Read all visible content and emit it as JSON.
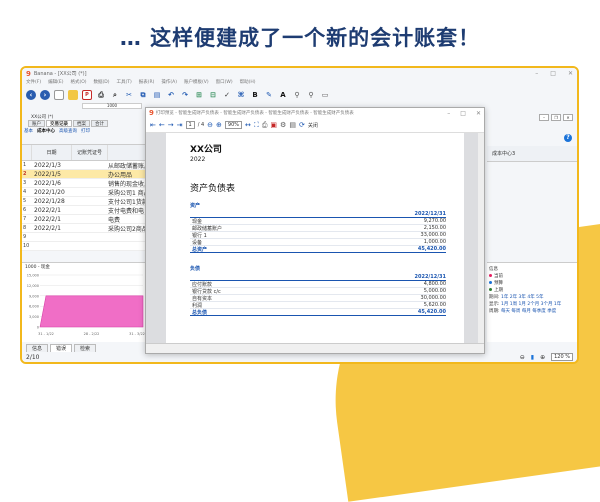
{
  "banner": "… 这样便建成了一个新的会计账套！",
  "app": {
    "title": "Banana - [XX公司 (*)]",
    "menu": [
      "文件(F)",
      "编辑(E)",
      "格式(O)",
      "数据(D)",
      "工具(T)",
      "报表(R)",
      "操作(A)",
      "账户模板(V)",
      "窗口(W)",
      "帮助(H)"
    ],
    "rownum": "1000",
    "file_tab": "XX公司 (*)",
    "doc_tabs": [
      "账户",
      "交易记录",
      "档案",
      "合计"
    ],
    "sub_tabs": [
      "基本",
      "成本中心",
      "高级查询",
      "打印"
    ],
    "columns": {
      "date": "日期",
      "voucher": "记账凭证号",
      "rightcol": "成本中心3"
    },
    "rows": [
      {
        "n": "1",
        "date": "2022/1/3",
        "desc": "从邮政储蓄账户"
      },
      {
        "n": "2",
        "date": "2022/1/5",
        "desc": "办公用品"
      },
      {
        "n": "3",
        "date": "2022/1/6",
        "desc": "销售的现金收入"
      },
      {
        "n": "4",
        "date": "2022/1/20",
        "desc": "采购公司1 商品"
      },
      {
        "n": "5",
        "date": "2022/1/28",
        "desc": "支付公司1货款"
      },
      {
        "n": "6",
        "date": "2022/2/1",
        "desc": "支付电费和电"
      },
      {
        "n": "7",
        "date": "2022/2/1",
        "desc": "电费"
      },
      {
        "n": "8",
        "date": "2022/2/1",
        "desc": "采购公司2商品"
      },
      {
        "n": "9",
        "date": "",
        "desc": ""
      },
      {
        "n": "10",
        "date": "",
        "desc": ""
      }
    ],
    "chart_title": "1000 - 现金",
    "chart_ticks": [
      "15,000",
      "12,000",
      "9,000",
      "6,000",
      "3,000",
      "0"
    ],
    "chart_xlabels": [
      "31 - 1/22",
      "28 - 2/22",
      "31 - 3/22"
    ],
    "bottom_tabs": [
      "信息",
      "错误",
      "检索"
    ],
    "status_left": "2/10",
    "zoom": "120 %",
    "right_info": {
      "heading": "信息",
      "legend": [
        "当前",
        "预算",
        "上期"
      ],
      "labels": [
        "期间:",
        "显示:",
        "周期:"
      ],
      "period_links": "1年 2年 3年 4年 5年",
      "show_links": "1月 1周 1月 2个月 3个月 1年",
      "cycle_links": "每天 每周 每月 每季度 季度"
    },
    "colors": {
      "accent": "#f2b81c",
      "link": "#1a55b0",
      "selected": "#fde9a6",
      "chart": "#f06ec6"
    }
  },
  "preview": {
    "title": "打印预览 - 智能生成财产负债表 - 智能生成财产负债表 - 智能生成财产负债表 - 智能生成财产负债表",
    "page_box": "1",
    "page_total": "/ 4",
    "zoom_box": "90%",
    "close_label": "关闭",
    "company": "XX公司",
    "year": "2022",
    "report_title": "资产负债表",
    "assets_heading": "资产",
    "assets_date": "2022/12/31",
    "assets": [
      {
        "label": "现金",
        "amount": "9,270.00"
      },
      {
        "label": "邮政储蓄账户",
        "amount": "2,150.00"
      },
      {
        "label": "银行 1",
        "amount": "33,000.00"
      },
      {
        "label": "设备",
        "amount": "1,000.00"
      },
      {
        "label": "总资产",
        "amount": "45,420.00",
        "total": true
      }
    ],
    "liab_heading": "负债",
    "liab_date": "2022/12/31",
    "liabilities": [
      {
        "label": "应付账款",
        "amount": "4,800.00"
      },
      {
        "label": "银行贷款 c/c",
        "amount": "5,000.00"
      },
      {
        "label": "自有资本",
        "amount": "30,000.00"
      },
      {
        "label": "利润",
        "amount": "5,620.00"
      },
      {
        "label": "总负债",
        "amount": "45,420.00",
        "total": true
      }
    ]
  },
  "chart_data": {
    "type": "area",
    "title": "1000 - 现金",
    "categories": [
      "31 - 1/22",
      "28 - 2/22",
      "31 - 3/22"
    ],
    "values": [
      9000,
      9000,
      9000
    ],
    "ylim": [
      0,
      15000
    ],
    "grid": true
  }
}
